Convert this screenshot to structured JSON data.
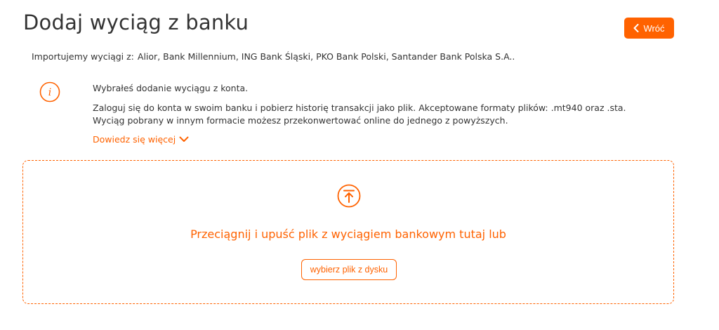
{
  "header": {
    "title": "Dodaj wyciąg z banku",
    "back_label": "Wróć"
  },
  "import": {
    "prefix": "Importujemy wyciągi z:",
    "banks": "Alior, Bank Millennium, ING Bank Śląski, PKO Bank Polski, Santander Bank Polska S.A.."
  },
  "info": {
    "icon": "info-icon",
    "line1": "Wybrałeś dodanie wyciągu z konta.",
    "line2": "Zaloguj się do konta w swoim banku i pobierz historię transakcji jako plik. Akceptowane formaty plików: .mt940 oraz .sta.",
    "line3": "Wyciąg pobrany w innym formacie możesz przekonwertować online do jednego z powyższych.",
    "learn_more": "Dowiedz się więcej"
  },
  "dropzone": {
    "icon": "upload-icon",
    "text": "Przeciągnij i upuść plik z wyciągiem bankowym tutaj lub",
    "button_label": "wybierz plik z dysku"
  },
  "colors": {
    "accent": "#ff6200",
    "text": "#333333",
    "background": "#ffffff"
  }
}
